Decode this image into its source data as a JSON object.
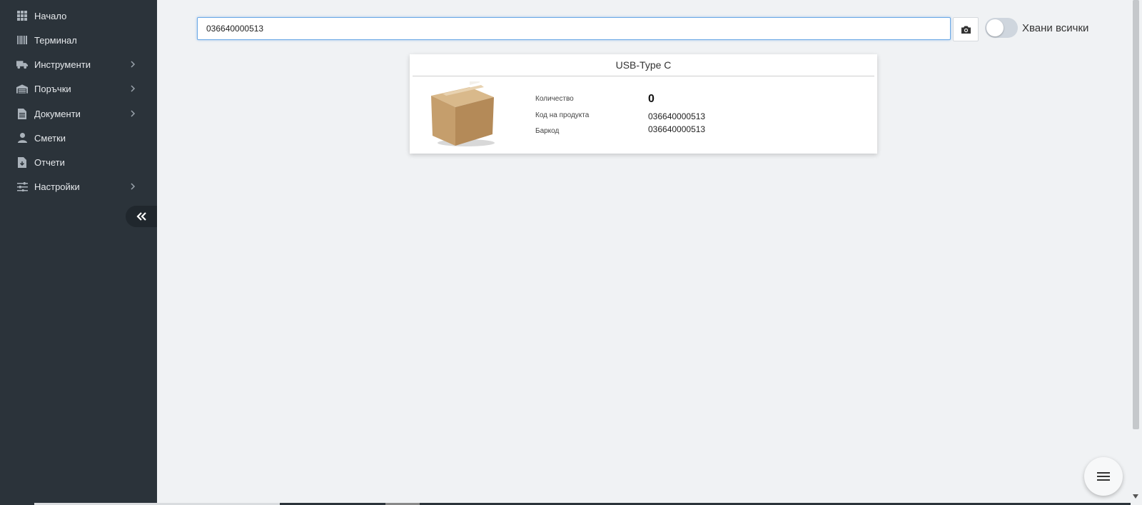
{
  "sidebar": {
    "items": [
      {
        "label": "Начало",
        "icon": "grid-icon",
        "has_submenu": false
      },
      {
        "label": "Терминал",
        "icon": "barcode-icon",
        "has_submenu": false
      },
      {
        "label": "Инструменти",
        "icon": "truck-icon",
        "has_submenu": true
      },
      {
        "label": "Поръчки",
        "icon": "warehouse-icon",
        "has_submenu": true
      },
      {
        "label": "Документи",
        "icon": "document-icon",
        "has_submenu": true
      },
      {
        "label": "Сметки",
        "icon": "user-icon",
        "has_submenu": false
      },
      {
        "label": "Отчети",
        "icon": "report-icon",
        "has_submenu": false
      },
      {
        "label": "Настройки",
        "icon": "sliders-icon",
        "has_submenu": true
      }
    ],
    "collapse_icon": "double-chevron-left-icon"
  },
  "search": {
    "value": "036640000513",
    "camera_icon": "camera-icon"
  },
  "toggle": {
    "label": "Хвани всички",
    "checked": false
  },
  "product": {
    "title": "USB-Type C",
    "image_icon": "cardboard-box-icon",
    "quantity_label": "Количество",
    "quantity_value": "0",
    "code_label": "Код на продукта",
    "code_value": "036640000513",
    "barcode_label": "Баркод",
    "barcode_value": "036640000513"
  },
  "fab": {
    "icon": "menu-icon"
  },
  "colors": {
    "sidebar_bg": "#2b333a",
    "content_bg": "#f0f2f4",
    "input_focus": "#6aa8e6"
  }
}
